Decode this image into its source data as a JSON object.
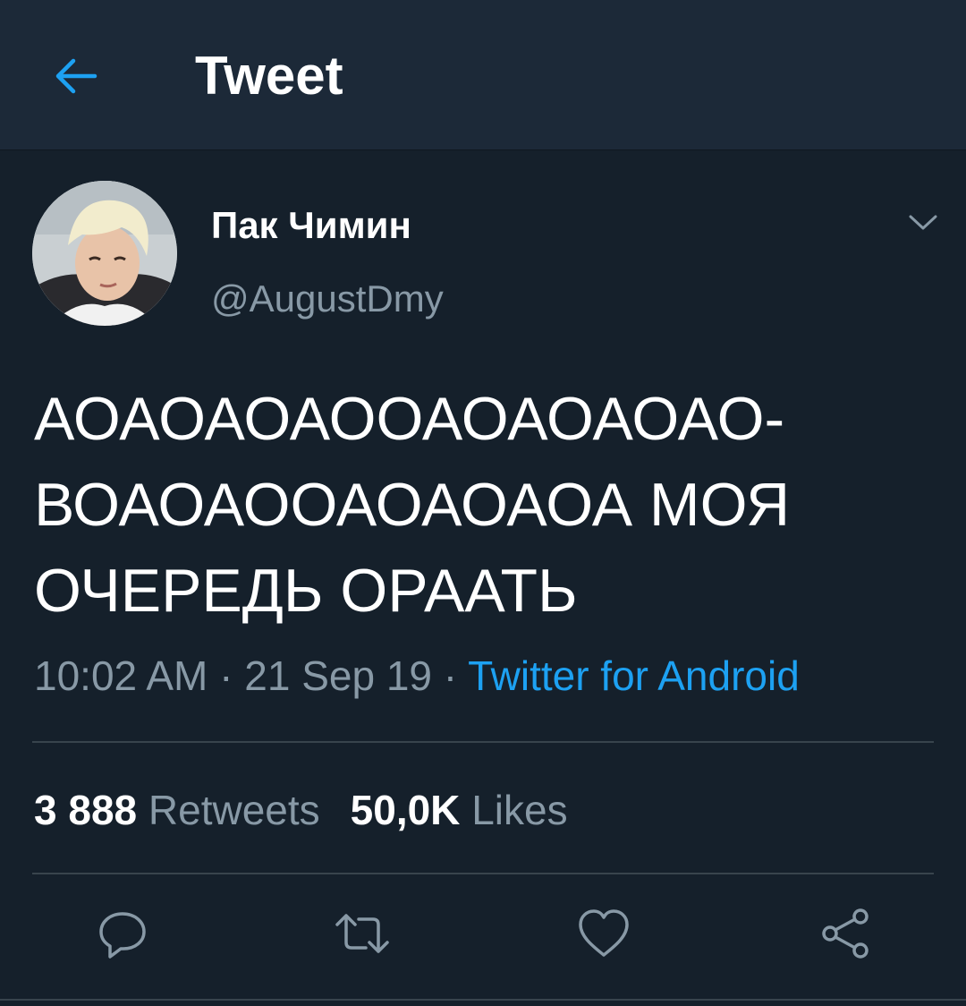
{
  "header": {
    "title": "Tweet",
    "back_icon": "arrow-left-icon"
  },
  "colors": {
    "background": "#15202b",
    "header_background": "#1c2938",
    "accent": "#1da1f2",
    "secondary_text": "#8899a6"
  },
  "tweet": {
    "author": {
      "display_name": "Пак Чимин",
      "handle": "@AugustDmy"
    },
    "text_lines": [
      "АОАОАОАООАОАОАОАО-",
      "ВОАОАООАОАОАОА МОЯ",
      "ОЧЕРЕДЬ ОРААТЬ"
    ],
    "time": "10:02 AM",
    "date": "21 Sep 19",
    "separator": " · ",
    "source": "Twitter for Android",
    "stats": {
      "retweets_count": "3 888",
      "retweets_label": "Retweets",
      "likes_count": "50,0K",
      "likes_label": "Likes"
    },
    "actions": [
      "reply-icon",
      "retweet-icon",
      "like-icon",
      "share-icon"
    ]
  }
}
